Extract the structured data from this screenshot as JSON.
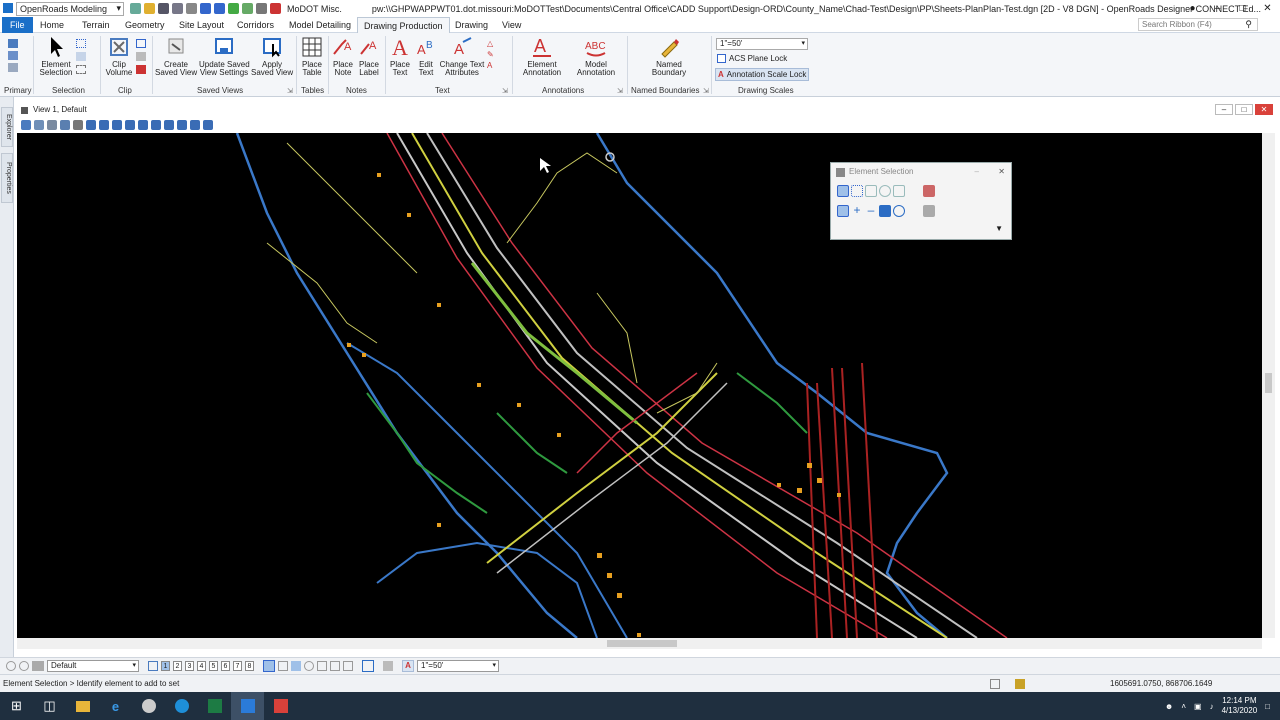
{
  "titlebar": {
    "workspace": "OpenRoads Modeling",
    "menu_label": "MoDOT Misc.",
    "path": "pw:\\\\GHPWAPPWT01.dot.missouri:MoDOTTest\\Documents\\Central Office\\CADD Support\\Design-ORD\\County_Name\\Chad-Test\\Design\\PP\\Sheets-PlanPlan-Test.dgn [2D - V8 DGN] - OpenRoads Designer CONNECT Ed..."
  },
  "tabs": [
    "File",
    "Home",
    "Terrain",
    "Geometry",
    "Site Layout",
    "Corridors",
    "Model Detailing",
    "Drawing Production",
    "Drawing",
    "View"
  ],
  "active_tab": "Drawing Production",
  "search_placeholder": "Search Ribbon (F4)",
  "ribbon": {
    "buttons": {
      "element_selection": "Element\nSelection",
      "clip_volume": "Clip\nVolume",
      "create_saved_view": "Create\nSaved View",
      "update_saved_view": "Update Saved\nView Settings",
      "apply_saved_view": "Apply\nSaved View",
      "place_table": "Place\nTable",
      "place_note": "Place\nNote",
      "place_label": "Place\nLabel",
      "place_text": "Place\nText",
      "edit_text": "Edit\nText",
      "change_text_attributes": "Change Text\nAttributes",
      "element_annotation": "Element\nAnnotation",
      "model_annotation": "Model\nAnnotation",
      "named_boundary": "Named\nBoundary"
    },
    "groups": [
      "Primary",
      "Selection",
      "Clip",
      "Saved Views",
      "Tables",
      "Notes",
      "Text",
      "Annotations",
      "Named Boundaries",
      "Drawing Scales"
    ],
    "scale_value": "1\"=50'",
    "acs_plane_lock": "ACS Plane Lock",
    "annotation_scale_lock": "Annotation Scale Lock"
  },
  "dock_tabs": [
    "Explorer",
    "Properties"
  ],
  "view": {
    "title": "View 1, Default"
  },
  "element_selection_dialog": {
    "title": "Element Selection"
  },
  "statusbar": {
    "level": "Default",
    "view_numbers": [
      "1",
      "2",
      "3",
      "4",
      "5",
      "6",
      "7",
      "8"
    ],
    "annotation_scale": "1\"=50'",
    "prompt": "Element Selection > Identify element to add to set",
    "coordinates": "1605691.0750, 868706.1649"
  },
  "taskbar": {
    "time": "12:14 PM",
    "date": "4/13/2020"
  },
  "colors": {
    "file_tab": "#1a6fc8",
    "canvas_bg": "#000000",
    "taskbar_bg": "#1f2f3f"
  }
}
